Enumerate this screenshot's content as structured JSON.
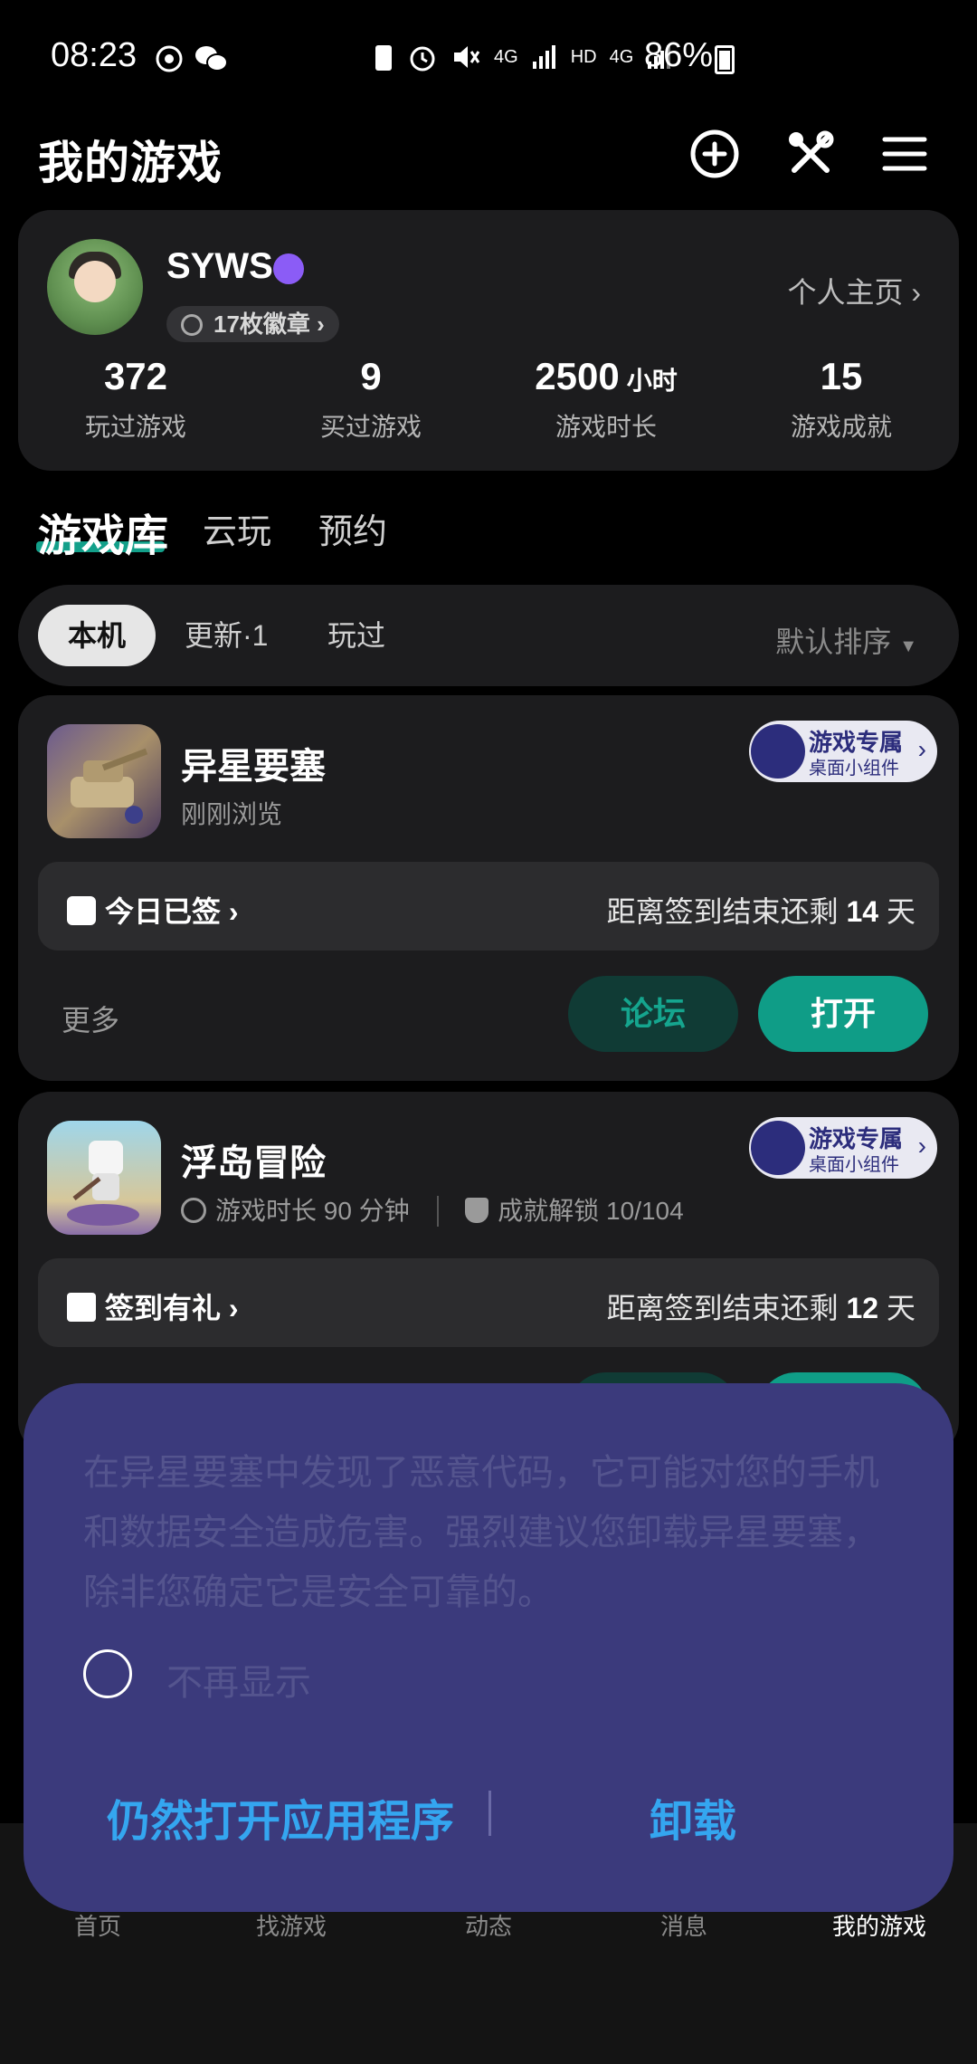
{
  "status_bar": {
    "time": "08:23",
    "battery": "86%",
    "net1": "4G",
    "hd": "HD",
    "net2": "4G"
  },
  "header": {
    "title": "我的游戏",
    "icons": [
      "add-circle-icon",
      "tools-icon",
      "menu-icon"
    ]
  },
  "profile": {
    "username": "SYWS",
    "badges": "17枚徽章",
    "home_link": "个人主页",
    "stats": [
      {
        "value": "372",
        "unit": "",
        "label": "玩过游戏"
      },
      {
        "value": "9",
        "unit": "",
        "label": "买过游戏"
      },
      {
        "value": "2500",
        "unit": "小时",
        "label": "游戏时长"
      },
      {
        "value": "15",
        "unit": "",
        "label": "游戏成就"
      }
    ]
  },
  "library_tabs": [
    "游戏库",
    "云玩",
    "预约"
  ],
  "filters": {
    "chips": [
      "本机",
      "更新·1",
      "玩过"
    ],
    "sort": "默认排序"
  },
  "widget": {
    "line1": "游戏专属",
    "line2": "桌面小组件"
  },
  "games": [
    {
      "title": "异星要塞",
      "sub": "刚刚浏览",
      "sign_left": "今日已签",
      "sign_right_prefix": "距离签到结束还剩",
      "sign_days": "14",
      "sign_unit": "天",
      "more": "更多",
      "forum": "论坛",
      "open": "打开"
    },
    {
      "title": "浮岛冒险",
      "playtime": "游戏时长 90 分钟",
      "achievements": "成就解锁 10/104",
      "sign_left": "签到有礼",
      "sign_right_prefix": "距离签到结束还剩",
      "sign_days": "12",
      "sign_unit": "天"
    }
  ],
  "bottom_nav": [
    "首页",
    "找游戏",
    "动态",
    "消息",
    "我的游戏"
  ],
  "dialog": {
    "message": "在异星要塞中发现了恶意代码，它可能对您的手机和数据安全造成危害。强烈建议您卸载异星要塞，除非您确定它是安全可靠的。",
    "checkbox_label": "不再显示",
    "open_anyway": "仍然打开应用程序",
    "uninstall": "卸载"
  },
  "colors": {
    "accent": "#0f9d87",
    "dialog_bg": "#3b3a7c",
    "dialog_button": "#34a6f0"
  }
}
